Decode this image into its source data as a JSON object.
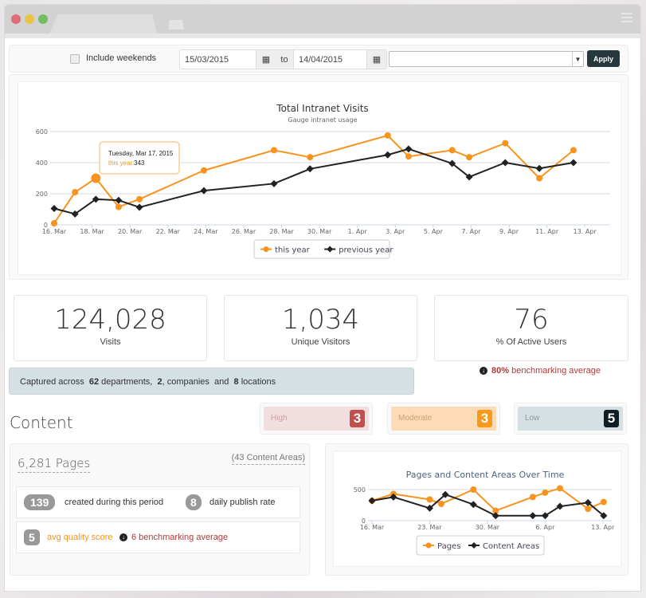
{
  "window": {
    "controls": [
      "close",
      "minimize",
      "maximize"
    ],
    "menu_icon": "hamburger-icon"
  },
  "filters": {
    "include_weekends_label": "Include weekends",
    "include_weekends_checked": false,
    "date_from": "15/03/2015",
    "date_to": "14/04/2015",
    "to_label": "to",
    "calendar_icon": "calendar-icon",
    "select_value": "",
    "apply_label": "Apply"
  },
  "main_chart": {
    "tooltip": {
      "date": "Tuesday, Mar 17, 2015",
      "series_label": "this year:",
      "value": "343"
    }
  },
  "stats": {
    "visits": {
      "value": "124,028",
      "label": "Visits"
    },
    "unique_visitors": {
      "value": "1,034",
      "label": "Unique Visitors"
    },
    "active_users": {
      "value": "76",
      "label": "% Of Active Users"
    },
    "benchmark": {
      "value": "80%",
      "text": "benchmarking average"
    }
  },
  "captured": {
    "prefix": "Captured across",
    "departments": "62",
    "departments_label": "departments,",
    "companies": "2",
    "companies_label": ", companies",
    "and_label": "and",
    "locations": "8",
    "locations_label": "locations"
  },
  "content": {
    "title": "Content",
    "severity": [
      {
        "label": "High",
        "count": "3",
        "bg": "#f2dede",
        "badge": "#c0504d",
        "text": "#c9a0a0"
      },
      {
        "label": "Moderate",
        "count": "3",
        "bg": "#fddcb5",
        "badge": "#f59a1c",
        "text": "#c9a07a"
      },
      {
        "label": "Low",
        "count": "5",
        "bg": "#d4e0e4",
        "badge": "#0f1d24",
        "text": "#8a9aa0"
      }
    ],
    "pages_total": "6,281 Pages",
    "content_areas": "(43 Content Areas)",
    "created": {
      "value": "139",
      "label": "created during this period"
    },
    "publish_rate": {
      "value": "8",
      "label": "daily publish rate"
    },
    "quality": {
      "value": "5",
      "label": "avg quality score",
      "benchmark": "6 benchmarking average"
    }
  },
  "colors": {
    "orange": "#f7931e",
    "black": "#222222",
    "bench_red": "#b03a3a",
    "apply_bg": "#24383d"
  },
  "chart_data": [
    {
      "type": "line",
      "title": "Total Intranet Visits",
      "subtitle": "Gauge intranet usage",
      "xlabel": "",
      "ylabel": "",
      "ylim": [
        0,
        600
      ],
      "yticks": [
        0,
        200,
        400,
        600
      ],
      "xlim_days": [
        0,
        29
      ],
      "xticks": [
        {
          "day": 0,
          "label": "16. Mar"
        },
        {
          "day": 2,
          "label": "18. Mar"
        },
        {
          "day": 4,
          "label": "20. Mar"
        },
        {
          "day": 6,
          "label": "22. Mar"
        },
        {
          "day": 8,
          "label": "24. Mar"
        },
        {
          "day": 10,
          "label": "26. Mar"
        },
        {
          "day": 12,
          "label": "28. Mar"
        },
        {
          "day": 14,
          "label": "30. Mar"
        },
        {
          "day": 16,
          "label": "1. Apr"
        },
        {
          "day": 18,
          "label": "3. Apr"
        },
        {
          "day": 20,
          "label": "5. Apr"
        },
        {
          "day": 22,
          "label": "7. Apr"
        },
        {
          "day": 24,
          "label": "9. Apr"
        },
        {
          "day": 26,
          "label": "11. Apr"
        },
        {
          "day": 28,
          "label": "13. Apr"
        }
      ],
      "grid": true,
      "legend": "bottom-center",
      "series": [
        {
          "name": "this year",
          "color": "#f7931e",
          "marker": "circle",
          "x": [
            0,
            1.1,
            2.2,
            3.4,
            4.5,
            7.9,
            11.6,
            13.5,
            17.6,
            18.7,
            21,
            21.9,
            23.8,
            25.6,
            27.4
          ],
          "values": [
            10,
            210,
            300,
            115,
            165,
            350,
            480,
            435,
            575,
            440,
            480,
            435,
            525,
            300,
            480
          ],
          "highlight_index": 2
        },
        {
          "name": "previous year",
          "color": "#222222",
          "marker": "diamond",
          "x": [
            0,
            1.1,
            2.2,
            3.4,
            4.5,
            7.9,
            11.6,
            13.5,
            17.6,
            18.7,
            21,
            21.9,
            23.8,
            25.6,
            27.4
          ],
          "values": [
            105,
            70,
            165,
            158,
            113,
            220,
            265,
            360,
            450,
            488,
            395,
            308,
            400,
            363,
            400
          ]
        }
      ]
    },
    {
      "type": "line",
      "title": "Pages and Content Areas Over Time",
      "xlabel": "",
      "ylabel": "",
      "ylim": [
        0,
        500
      ],
      "yticks": [
        0,
        500
      ],
      "xlim_days": [
        0,
        28.5
      ],
      "xticks": [
        {
          "day": 0,
          "label": "16. Mar"
        },
        {
          "day": 7,
          "label": "23. Mar"
        },
        {
          "day": 14,
          "label": "30. Mar"
        },
        {
          "day": 21,
          "label": "6. Apr"
        },
        {
          "day": 28,
          "label": "13. Apr"
        }
      ],
      "grid": true,
      "legend": "bottom-center",
      "series": [
        {
          "name": "Pages",
          "color": "#f7931e",
          "marker": "circle",
          "x": [
            0,
            2.6,
            7,
            8.4,
            12.3,
            15,
            19.5,
            21,
            22.8,
            26.2,
            28.1
          ],
          "values": [
            320,
            430,
            340,
            270,
            500,
            160,
            380,
            450,
            520,
            190,
            300
          ]
        },
        {
          "name": "Content Areas",
          "color": "#222222",
          "marker": "diamond",
          "x": [
            0,
            2.6,
            7,
            8.9,
            12.3,
            15,
            19.5,
            21,
            22.8,
            26.2,
            28.1
          ],
          "values": [
            320,
            380,
            200,
            420,
            260,
            80,
            80,
            80,
            230,
            290,
            80
          ]
        }
      ]
    }
  ]
}
